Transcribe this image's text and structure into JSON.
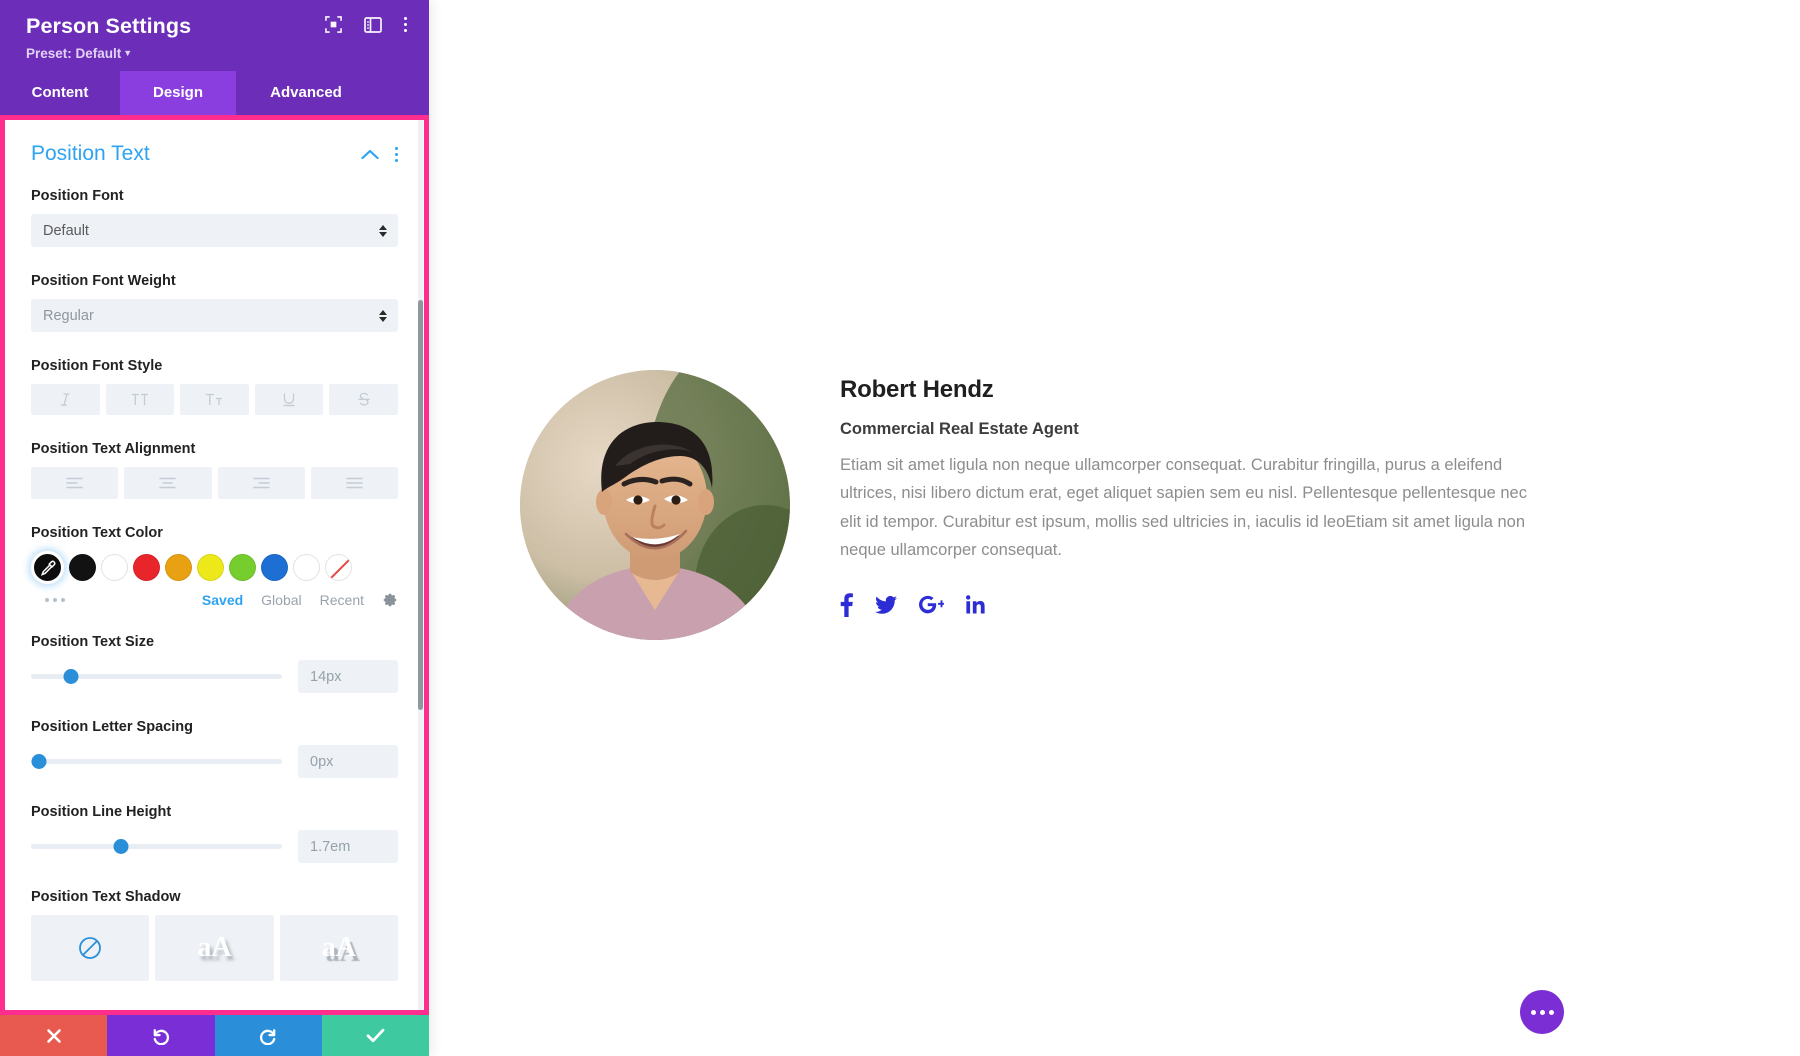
{
  "panel": {
    "title": "Person Settings",
    "preset_label": "Preset: Default",
    "header_icons": [
      {
        "name": "focus-target-icon"
      },
      {
        "name": "panel-layout-icon"
      },
      {
        "name": "more-vertical-icon"
      }
    ],
    "tabs": [
      {
        "label": "Content",
        "active": false
      },
      {
        "label": "Design",
        "active": true
      },
      {
        "label": "Advanced",
        "active": false
      }
    ],
    "section": {
      "title": "Position Text",
      "collapsed": false
    },
    "fields": {
      "font": {
        "label": "Position Font",
        "value": "Default"
      },
      "font_weight": {
        "label": "Position Font Weight",
        "value": "Regular"
      },
      "font_style": {
        "label": "Position Font Style",
        "buttons": [
          {
            "name": "italic-icon",
            "glyph": "I"
          },
          {
            "name": "uppercase-icon",
            "glyph": "TT"
          },
          {
            "name": "small-caps-icon",
            "glyph": "Tт"
          },
          {
            "name": "underline-icon",
            "glyph": "U"
          },
          {
            "name": "strikethrough-icon",
            "glyph": "S"
          }
        ]
      },
      "text_alignment": {
        "label": "Position Text Alignment",
        "buttons": [
          {
            "name": "align-left-icon"
          },
          {
            "name": "align-center-icon"
          },
          {
            "name": "align-right-icon"
          },
          {
            "name": "align-justify-icon"
          }
        ]
      },
      "text_color": {
        "label": "Position Text Color",
        "selected_name": "eyedropper-swatch",
        "selected_color": "#0d0d0d",
        "swatches": [
          {
            "name": "swatch-black",
            "color": "#121212"
          },
          {
            "name": "swatch-white",
            "color": "#ffffff"
          },
          {
            "name": "swatch-red",
            "color": "#e8252a"
          },
          {
            "name": "swatch-orange",
            "color": "#e8a113"
          },
          {
            "name": "swatch-yellow",
            "color": "#ece81a"
          },
          {
            "name": "swatch-green",
            "color": "#76cd2e"
          },
          {
            "name": "swatch-blue",
            "color": "#1d6fd4"
          },
          {
            "name": "swatch-white-2",
            "color": "#ffffff"
          },
          {
            "name": "swatch-none",
            "color": "none"
          }
        ],
        "tabs": [
          {
            "label": "Saved",
            "active": true
          },
          {
            "label": "Global",
            "active": false
          },
          {
            "label": "Recent",
            "active": false
          }
        ],
        "settings_icon": "gear-icon",
        "more_icon": "more-horizontal-icon"
      },
      "text_size": {
        "label": "Position Text Size",
        "value": "14px",
        "knob_percent": 16
      },
      "letter_spacing": {
        "label": "Position Letter Spacing",
        "value": "0px",
        "knob_percent": 3
      },
      "line_height": {
        "label": "Position Line Height",
        "value": "1.7em",
        "knob_percent": 36
      },
      "text_shadow": {
        "label": "Position Text Shadow",
        "buttons": [
          {
            "name": "shadow-none-icon",
            "glyph": ""
          },
          {
            "name": "shadow-soft-icon",
            "glyph": "aA"
          },
          {
            "name": "shadow-hard-icon",
            "glyph": "aA"
          }
        ]
      }
    },
    "actions": [
      {
        "name": "cancel-button",
        "icon": "close-icon",
        "color": "#e8594f"
      },
      {
        "name": "undo-button",
        "icon": "undo-icon",
        "color": "#7a2fd6"
      },
      {
        "name": "redo-button",
        "icon": "redo-icon",
        "color": "#2a8fd8"
      },
      {
        "name": "save-button",
        "icon": "check-icon",
        "color": "#3ec9a0"
      }
    ],
    "highlight_color": "#ff2d8e",
    "brand_color": "#6c2eb9"
  },
  "preview": {
    "person": {
      "name": "Robert Hendz",
      "position": "Commercial Real Estate Agent",
      "description": "Etiam sit amet ligula non neque ullamcorper consequat. Curabitur fringilla, purus a eleifend ultrices, nisi libero dictum erat, eget aliquet sapien sem eu nisl. Pellentesque pellentesque nec elit id tempor. Curabitur est ipsum, mollis sed ultricies in, iaculis id leoEtiam sit amet ligula non neque ullamcorper consequat.",
      "photo_name": "person-portrait-photo",
      "social": [
        {
          "name": "facebook-icon",
          "label": "f"
        },
        {
          "name": "twitter-icon",
          "label": "t"
        },
        {
          "name": "google-plus-icon",
          "label": "G+"
        },
        {
          "name": "linkedin-icon",
          "label": "in"
        }
      ],
      "social_color": "#2d2dd6"
    },
    "fab": {
      "name": "page-settings-fab",
      "icon": "more-horizontal-icon",
      "color": "#7b2ed4"
    }
  }
}
